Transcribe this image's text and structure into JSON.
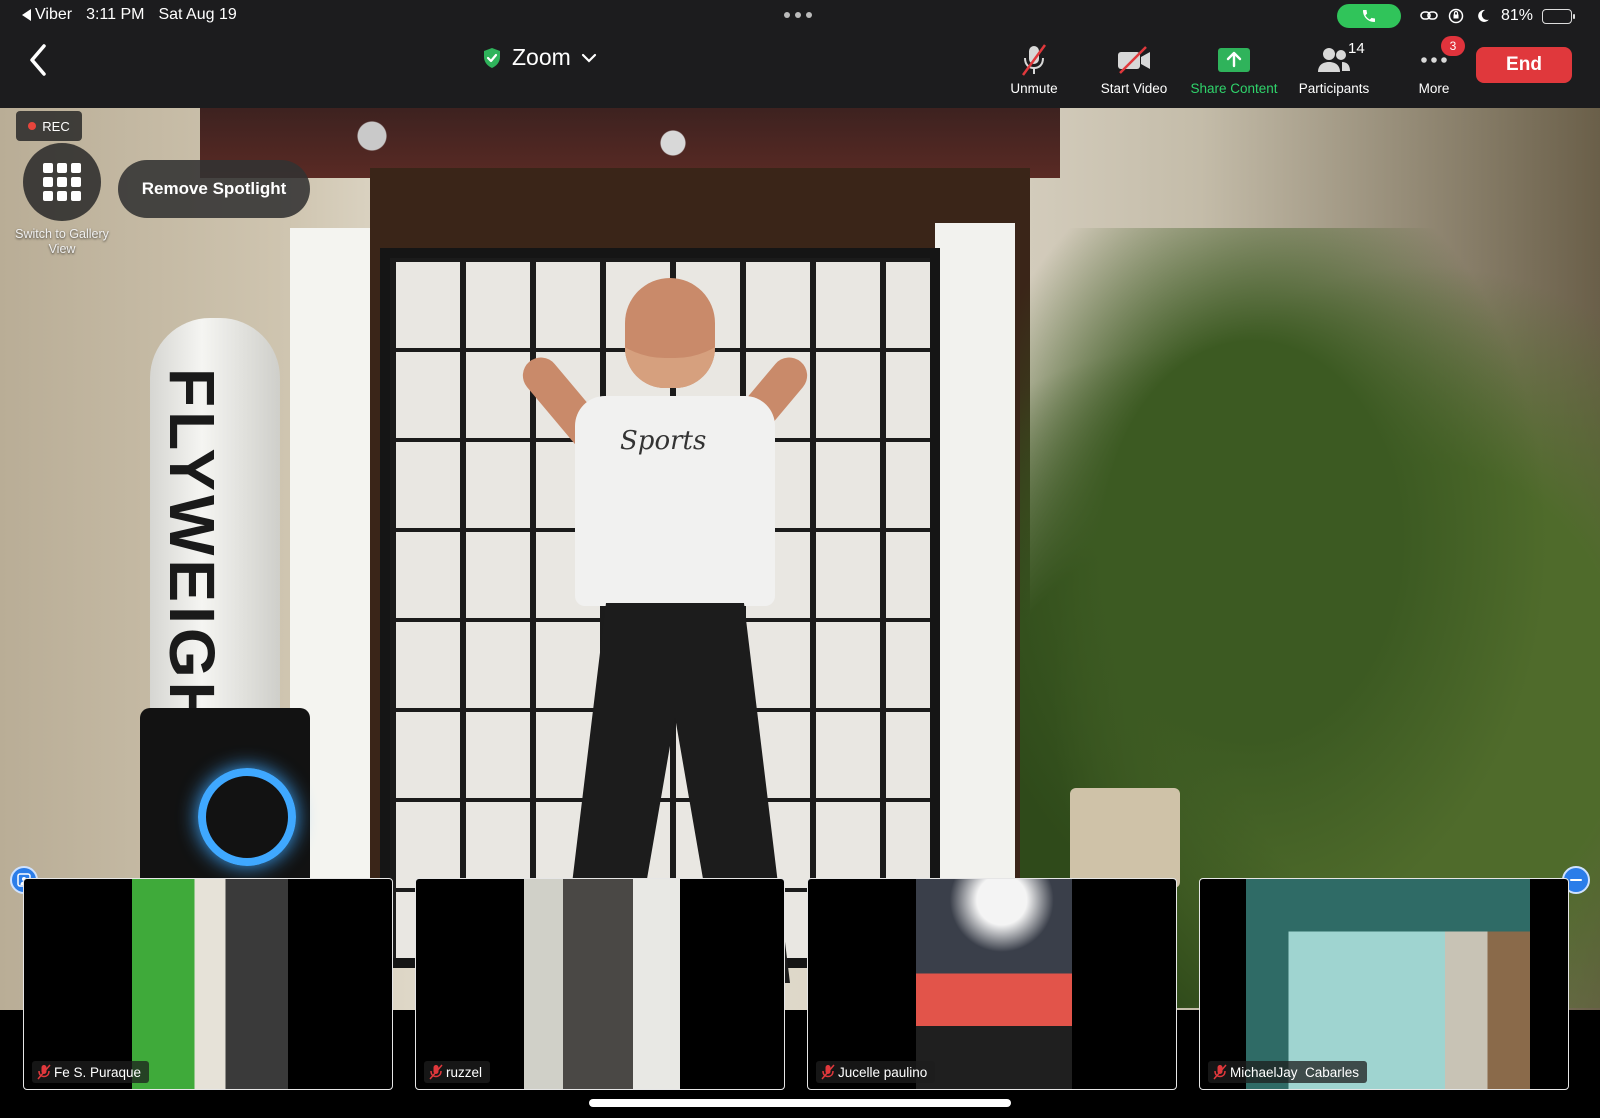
{
  "status_bar": {
    "back_app": "Viber",
    "time": "3:11 PM",
    "date": "Sat Aug 19",
    "battery": "81%",
    "battery_level": 0.81
  },
  "toolbar": {
    "title": "Zoom",
    "actions": {
      "unmute": "Unmute",
      "start_video": "Start Video",
      "share_content": "Share Content",
      "participants": "Participants",
      "participants_count": "14",
      "more": "More",
      "more_badge": "3"
    },
    "end_label": "End"
  },
  "stage": {
    "rec_label": "REC",
    "gallery_label": "Switch to Gallery View",
    "remove_spotlight_label": "Remove Spotlight",
    "bag_text": "FLYWEIGH",
    "shirt_text": "Sports"
  },
  "thumbnails": [
    {
      "name": "Fe S. Puraque"
    },
    {
      "name": "ruzzel"
    },
    {
      "name": "Jucelle paulino"
    },
    {
      "name": "MichaelJay  Cabarles"
    }
  ],
  "colors": {
    "end_button": "#e0383c",
    "share_green": "#2fd36b",
    "rec_dot": "#e8453c",
    "collapse_blue": "#2b7de9",
    "call_pill": "#30c45a"
  }
}
